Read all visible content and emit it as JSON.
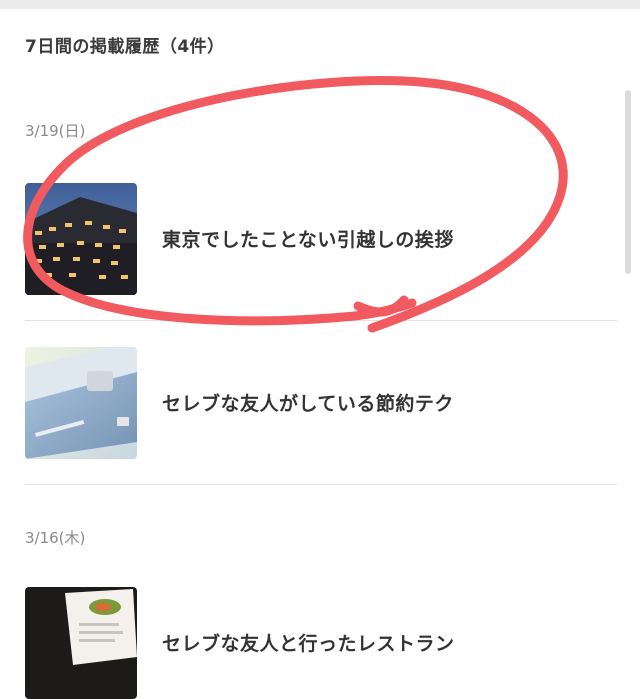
{
  "header": {
    "title": "7日間の掲載履歴（4件）"
  },
  "sections": [
    {
      "date": "3/19(日)",
      "items": [
        {
          "title": "東京でしたことない引越しの挨拶",
          "thumbnail_icon": "night-apartment-building-image"
        },
        {
          "title": "セレブな友人がしている節約テク",
          "thumbnail_icon": "credit-cards-image"
        }
      ]
    },
    {
      "date": "3/16(木)",
      "items": [
        {
          "title": "セレブな友人と行ったレストラン",
          "thumbnail_icon": "restaurant-menu-image"
        }
      ]
    }
  ],
  "annotation": {
    "type": "hand-drawn-circle",
    "color": "#f15a5f"
  }
}
